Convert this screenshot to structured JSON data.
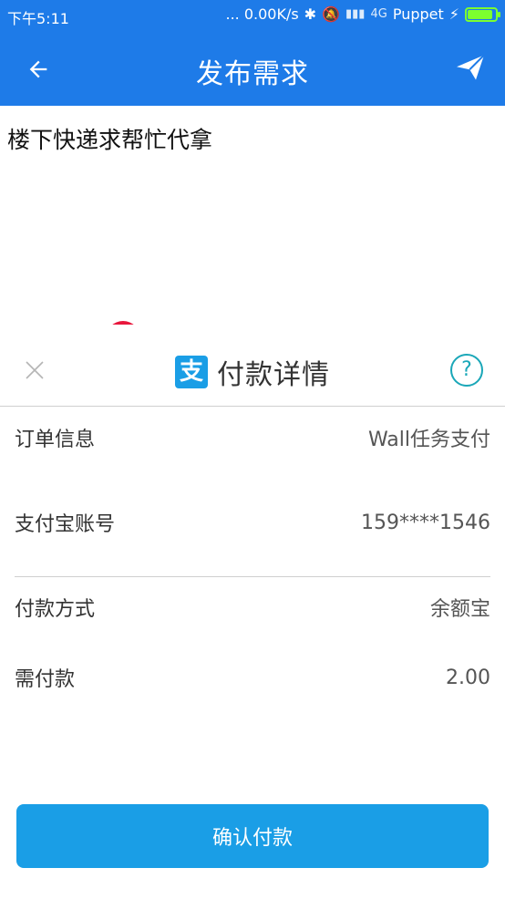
{
  "status_bar": {
    "time": "下午5:11",
    "network_speed": "... 0.00K/s",
    "signal_text": "4G",
    "carrier": "Puppet",
    "battery_level": 0.85
  },
  "app_bar": {
    "title": "发布需求",
    "back_icon": "arrow-left-icon",
    "send_icon": "send-icon"
  },
  "content": {
    "request_text": "楼下快递求帮忙代拿"
  },
  "payment_sheet": {
    "title": "付款详情",
    "logo_char": "支",
    "help_glyph": "?",
    "rows": [
      {
        "label": "订单信息",
        "value": "Wall任务支付"
      },
      {
        "label": "支付宝账号",
        "value": "159****1546"
      },
      {
        "label": "付款方式",
        "value": "余额宝"
      },
      {
        "label": "需付款",
        "value": "2.00"
      }
    ],
    "confirm_label": "确认付款"
  },
  "colors": {
    "primary": "#1e7be8",
    "accent": "#1a9ee6",
    "danger": "#e8163c",
    "battery": "#7cff2f"
  }
}
